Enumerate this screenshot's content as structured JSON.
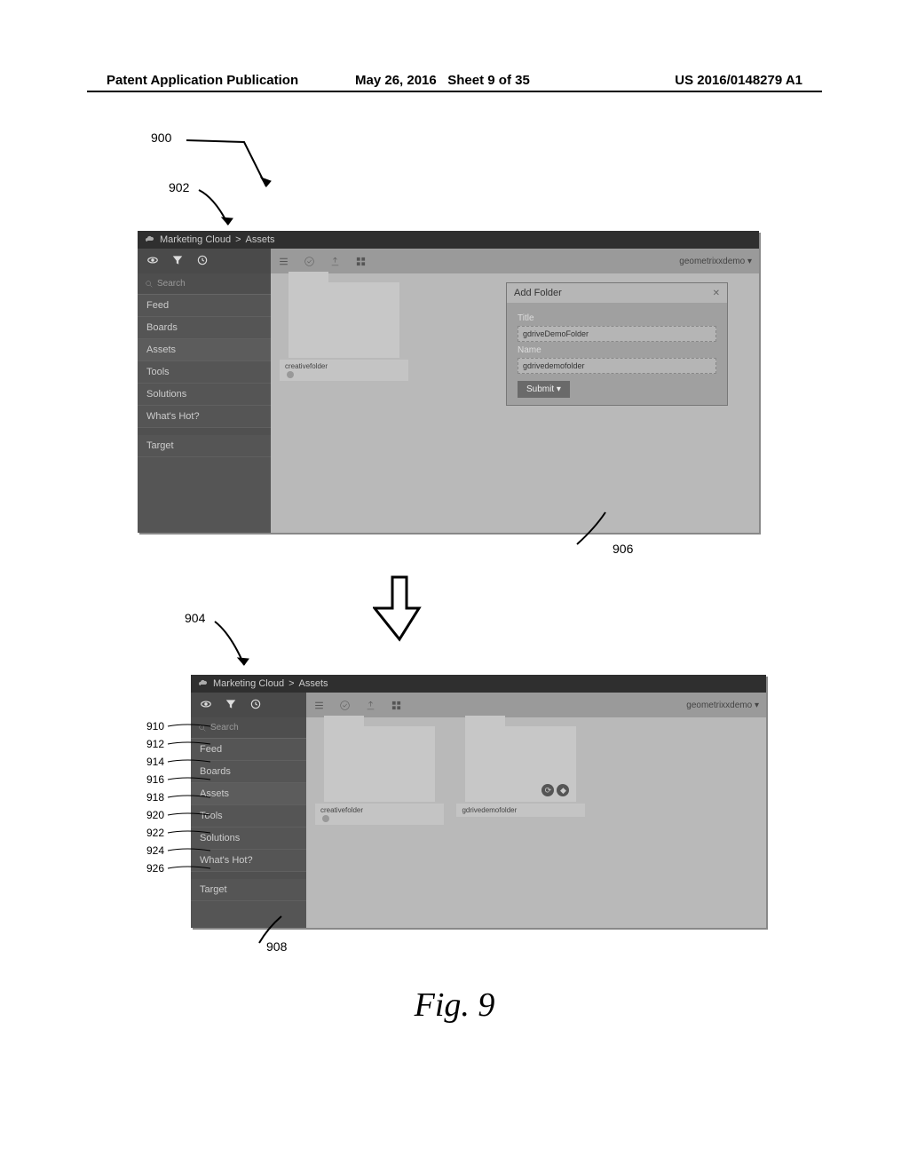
{
  "page": {
    "pub_label": "Patent Application Publication",
    "date": "May 26, 2016",
    "sheet": "Sheet 9 of 35",
    "pub_number": "US 2016/0148279 A1",
    "figure_label": "Fig. 9"
  },
  "callouts": {
    "c900": "900",
    "c902": "902",
    "c904": "904",
    "c906": "906",
    "c908": "908",
    "rows": [
      "910",
      "912",
      "914",
      "916",
      "918",
      "920",
      "922",
      "924",
      "926"
    ]
  },
  "ui": {
    "breadcrumb_root": "Marketing Cloud",
    "breadcrumb_sep": ">",
    "breadcrumb_leaf": "Assets",
    "user_label": "geometrixxdemo",
    "search_placeholder": "Search",
    "nav": {
      "feed": "Feed",
      "boards": "Boards",
      "assets": "Assets",
      "tools": "Tools",
      "solutions": "Solutions",
      "whats_hot": "What's Hot?",
      "sub_hot": "",
      "target": "Target"
    },
    "folders": {
      "f1": "creativefolder",
      "f2": "gdrivedemofolder"
    },
    "dialog": {
      "title": "Add Folder",
      "field_title_label": "Title",
      "field_title_value": "gdriveDemoFolder",
      "field_name_label": "Name",
      "field_name_value": "gdrivedemofolder",
      "submit": "Submit"
    }
  }
}
